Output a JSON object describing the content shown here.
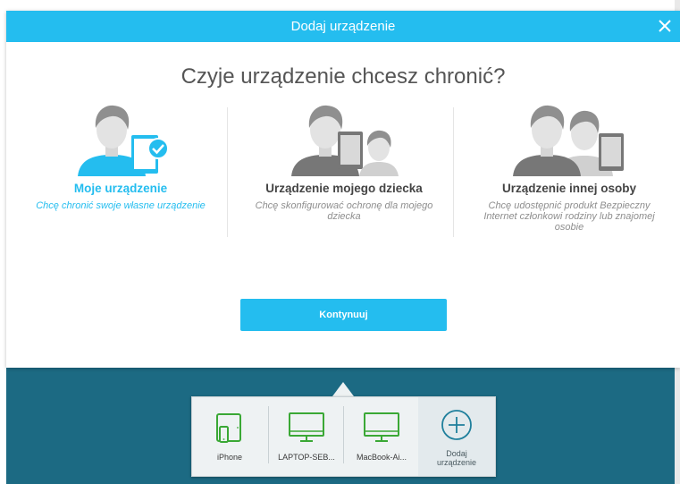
{
  "dialog": {
    "title": "Dodaj urządzenie",
    "headline": "Czyje urządzenie chcesz chronić?",
    "continue_label": "Kontynuuj",
    "accent_color": "#24bdef",
    "selected_option": "moje-urzadzenie"
  },
  "options": [
    {
      "title": "Moje urządzenie",
      "description": "Chcę chronić swoje własne urządzenie",
      "selected": true
    },
    {
      "title": "Urządzenie mojego dziecka",
      "description": "Chcę skonfigurować ochronę dla mojego dziecka",
      "selected": false
    },
    {
      "title": "Urządzenie innej osoby",
      "description": "Chcę udostępnić produkt Bezpieczny Internet członkowi rodziny lub znajomej osobie",
      "selected": false
    }
  ],
  "devices": [
    {
      "label": "iPhone",
      "icon": "tablet-phone-icon"
    },
    {
      "label": "LAPTOP-SEB...",
      "icon": "monitor-icon"
    },
    {
      "label": "MacBook-Ai...",
      "icon": "monitor-icon"
    }
  ],
  "add_device": {
    "line1": "Dodaj",
    "line2": "urządzenie",
    "icon": "plus-circle-icon"
  },
  "colors": {
    "header": "#24bdef",
    "backdrop": "#1c6a83",
    "device_icon": "#3aa835"
  }
}
